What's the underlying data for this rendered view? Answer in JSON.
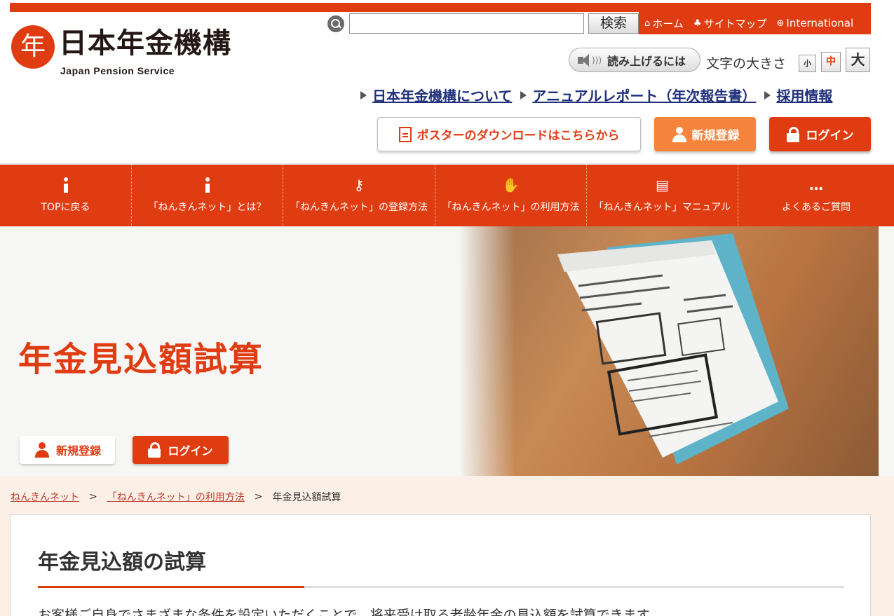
{
  "header": {
    "logo_glyph": "年",
    "logo_title": "日本年金機構",
    "logo_subtitle": "Japan Pension Service",
    "search": {
      "value": "",
      "button_label": "検索"
    },
    "util_links": [
      {
        "icon": "home-icon",
        "glyph": "⌂",
        "label": "ホーム"
      },
      {
        "icon": "sitemap-icon",
        "glyph": "♣",
        "label": "サイトマップ"
      },
      {
        "icon": "globe-icon",
        "glyph": "⊕",
        "label": "International"
      }
    ],
    "read_aloud_label": "読み上げるには",
    "font_size": {
      "label": "文字の大きさ",
      "small": "小",
      "medium": "中",
      "large": "大"
    },
    "org_links": [
      "日本年金機構について",
      "アニュアルレポート（年次報告書）",
      "採用情報"
    ],
    "poster_button": "ポスターのダウンロードはこちらから",
    "register_button": "新規登録",
    "login_button": "ログイン"
  },
  "nav": {
    "items": [
      {
        "icon": "info-icon",
        "label": "TOPに戻る"
      },
      {
        "icon": "info-icon",
        "label": "「ねんきんネット」とは？"
      },
      {
        "icon": "key-icon",
        "glyph": "⚷",
        "label": "「ねんきんネット」の登録方法"
      },
      {
        "icon": "hand-icon",
        "glyph": "✋",
        "label": "「ねんきんネット」の利用方法"
      },
      {
        "icon": "manual-icon",
        "glyph": "▤",
        "label": "「ねんきんネット」マニュアル"
      },
      {
        "icon": "faq-icon",
        "glyph": "…",
        "label": "よくあるご質問"
      }
    ]
  },
  "hero": {
    "title": "年金見込額試算",
    "register_button": "新規登録",
    "login_button": "ログイン"
  },
  "breadcrumb": {
    "items": [
      "ねんきんネット",
      "「ねんきんネット」の利用方法"
    ],
    "separator": ">",
    "current": "年金見込額試算"
  },
  "main": {
    "title": "年金見込額の試算",
    "intro": "お客様ご自身でさまざまな条件を設定いただくことで、将来受け取る老齢年金の見込額を試算できます。"
  },
  "colors": {
    "brand": "#e03c12",
    "accent_orange": "#f7843c",
    "link_navy": "#1f2f7a"
  }
}
